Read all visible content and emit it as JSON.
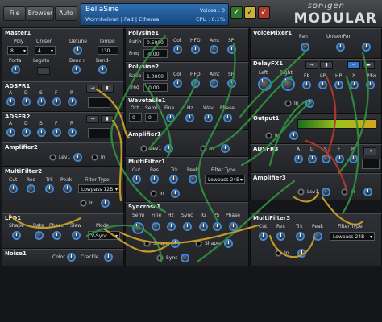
{
  "toolbar": {
    "file": "File",
    "browser": "Browser",
    "auto": "Auto"
  },
  "preset": {
    "name": "BellaSine",
    "category": "Wormhelmet | Pad | Ethereal",
    "voices": "Voices : 0",
    "cpu": "CPU : 0.1%"
  },
  "brand": {
    "line1": "sonigen",
    "line2": "MODULAR"
  },
  "modules": {
    "master": {
      "title": "Master1",
      "poly_label": "Poly",
      "poly": "8",
      "unison_label": "Unison",
      "unison": "4",
      "detune_label": "Detune",
      "tempo_label": "Tempo",
      "tempo": "130",
      "porta_label": "Porta",
      "legato_label": "Legato",
      "bendp_label": "Bend+",
      "bendm_label": "Bend-"
    },
    "adsfr1": {
      "title": "ADSFR1",
      "knobs": [
        "A",
        "D",
        "S",
        "F",
        "R"
      ]
    },
    "adsfr2": {
      "title": "ADSFR2",
      "knobs": [
        "A",
        "D",
        "S",
        "F",
        "R"
      ]
    },
    "amp2": {
      "title": "Amplifier2",
      "lev": "Lev1",
      "in": "In"
    },
    "mf2": {
      "title": "MultiFilter2",
      "cut": "Cut",
      "res": "Res",
      "trk": "Trk",
      "peak": "Peak",
      "ftype_label": "Filter Type",
      "ftype": "Lowpass 12B",
      "in": "In"
    },
    "lfo1": {
      "title": "LFO1",
      "shape": "Shape",
      "rate": "Rate",
      "phase": "Phase",
      "slew": "Slew",
      "mode": "Mode",
      "mode_value": "V-Sync"
    },
    "noise": {
      "title": "Noise1",
      "color": "Color",
      "crackle": "Crackle"
    },
    "poly1": {
      "title": "Polysine1",
      "ratio": "Ratio",
      "ratio_val": "0.5000",
      "freq": "Freq",
      "freq_val": "-0.00",
      "col": "Col",
      "hfd": "HFD",
      "amt": "Amt",
      "sp": "SP"
    },
    "poly2": {
      "title": "Polysine2",
      "ratio": "Ratio",
      "ratio_val": "1.0000",
      "freq": "Freq",
      "freq_val": "-0.00",
      "col": "Col",
      "hfd": "HFD",
      "amt": "Amt",
      "sp": "SP"
    },
    "wt1": {
      "title": "Wavetable1",
      "oct": "Oct",
      "semi": "Semi",
      "fine": "Fine",
      "hz": "Hz",
      "wav": "Wav",
      "phase": "Phase",
      "oct_val": "0",
      "semi_val": "0"
    },
    "amp1": {
      "title": "Amplifier1",
      "lev": "Lev1",
      "in": "In"
    },
    "mf1": {
      "title": "MultiFilter1",
      "cut": "Cut",
      "res": "Res",
      "trk": "Trk",
      "peak": "Peak",
      "ftype_label": "Filter Type",
      "ftype": "Lowpass 24B",
      "in": "In"
    },
    "sync1": {
      "title": "Syncrosc1",
      "semi": "Semi",
      "fine": "Fine",
      "hz": "Hz",
      "sync": "Sync",
      "ig": "IG",
      "ps": "PS",
      "phase": "Phase",
      "shape1": "Shape",
      "shape2": "Shape",
      "sync_in": "Sync"
    },
    "vm1": {
      "title": "VoiceMixer1",
      "pan": "Pan",
      "upan": "UnisonPan"
    },
    "delay1": {
      "title": "DelayFX1",
      "left": "Left",
      "right": "Right",
      "fb": "Fb",
      "lp": "LP",
      "hp": "HP",
      "x": "X",
      "mix": "Mix",
      "in": "In"
    },
    "out1": {
      "title": "Output1",
      "in": "In"
    },
    "adsfr3": {
      "title": "ADSFR3",
      "knobs": [
        "A",
        "D",
        "S",
        "F",
        "R"
      ]
    },
    "amp3": {
      "title": "Amplifier3",
      "lev": "Lev1",
      "in": "In"
    },
    "mf3": {
      "title": "MultiFilter3",
      "cut": "Cut",
      "res": "Res",
      "trk": "Trk",
      "peak": "Peak",
      "ftype_label": "Filter Type",
      "ftype": "Lowpass 24B",
      "in": "In"
    }
  },
  "colors": {
    "cable_green": "#2f8f3f",
    "cable_yellow": "#c9a02a",
    "cable_red": "#b23a2a",
    "knob_ring": "#3d8ad8",
    "lcd_blue": "#1f5a9a"
  }
}
